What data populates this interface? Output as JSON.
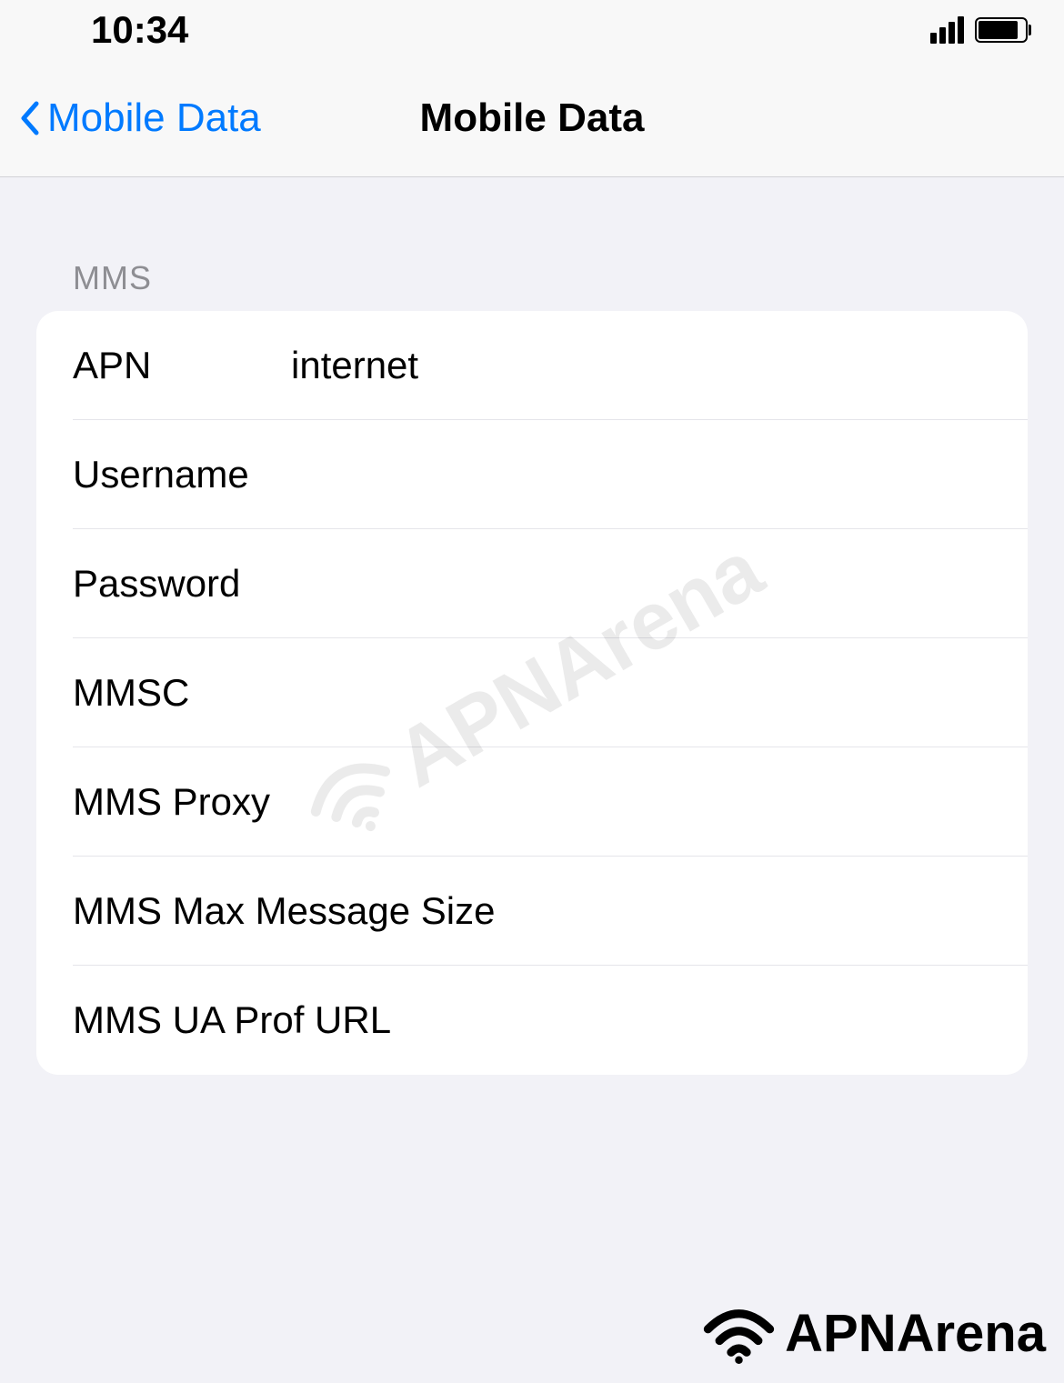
{
  "statusBar": {
    "time": "10:34"
  },
  "navigation": {
    "backLabel": "Mobile Data",
    "title": "Mobile Data"
  },
  "section": {
    "header": "MMS"
  },
  "fields": {
    "apn": {
      "label": "APN",
      "value": "internet"
    },
    "username": {
      "label": "Username",
      "value": ""
    },
    "password": {
      "label": "Password",
      "value": ""
    },
    "mmsc": {
      "label": "MMSC",
      "value": ""
    },
    "mmsProxy": {
      "label": "MMS Proxy",
      "value": ""
    },
    "mmsMaxSize": {
      "label": "MMS Max Message Size",
      "value": ""
    },
    "mmsUaProf": {
      "label": "MMS UA Prof URL",
      "value": ""
    }
  },
  "branding": {
    "watermark": "APNArena",
    "footer": "APNArena"
  }
}
